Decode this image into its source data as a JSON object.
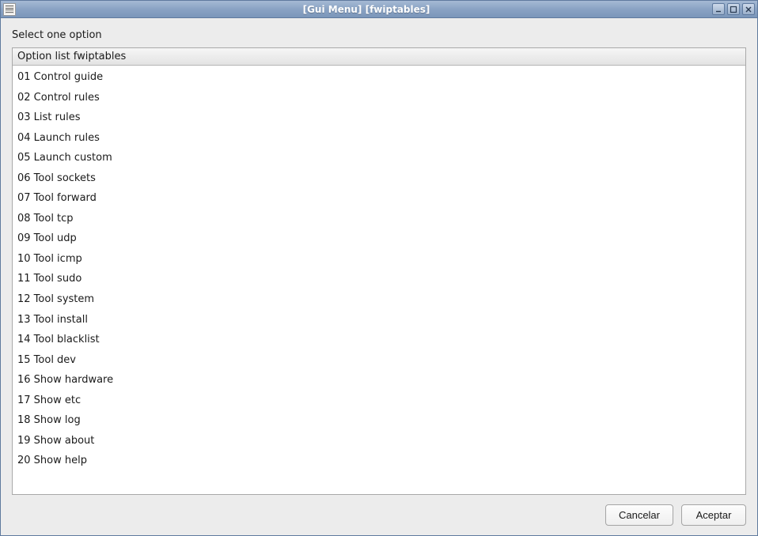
{
  "window": {
    "title": "[Gui Menu]  [fwiptables]"
  },
  "prompt": "Select one option",
  "column_header": "Option list fwiptables",
  "options": [
    "01 Control guide",
    "02 Control rules",
    "03 List rules",
    "04 Launch rules",
    "05 Launch custom",
    "06 Tool sockets",
    "07 Tool forward",
    "08 Tool tcp",
    "09 Tool udp",
    "10 Tool icmp",
    "11 Tool sudo",
    "12 Tool system",
    "13 Tool install",
    "14 Tool blacklist",
    "15 Tool dev",
    "16 Show hardware",
    "17 Show etc",
    "18 Show log",
    "19 Show about",
    "20 Show help"
  ],
  "buttons": {
    "cancel": "Cancelar",
    "accept": "Aceptar"
  }
}
